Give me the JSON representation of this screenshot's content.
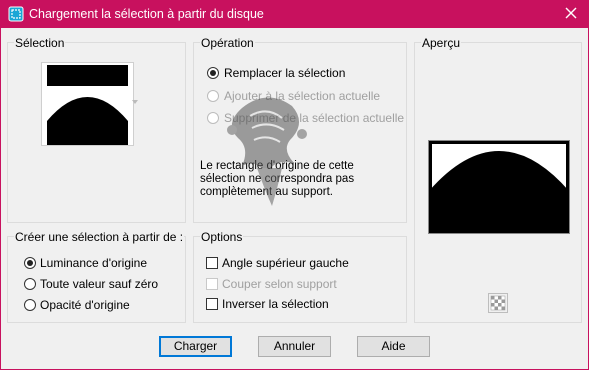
{
  "window": {
    "title": "Chargement la sélection à partir du disque",
    "close_glyph": "✕"
  },
  "selection_group": {
    "label": "Sélection"
  },
  "operation_group": {
    "label": "Opération",
    "options": [
      {
        "label": "Remplacer la sélection",
        "checked": true,
        "enabled": true
      },
      {
        "label": "Ajouter à la sélection actuelle",
        "checked": false,
        "enabled": false
      },
      {
        "label": "Supprimer de la sélection actuelle",
        "checked": false,
        "enabled": false
      }
    ],
    "info_text": "Le rectangle d'origine de cette sélection ne correspondra pas complètement au support."
  },
  "preview_group": {
    "label": "Aperçu"
  },
  "create_group": {
    "label": "Créer une sélection à partir de :",
    "options": [
      {
        "label": "Luminance d'origine",
        "checked": true
      },
      {
        "label": "Toute valeur sauf zéro",
        "checked": false
      },
      {
        "label": "Opacité d'origine",
        "checked": false
      }
    ]
  },
  "options_group": {
    "label": "Options",
    "items": [
      {
        "label": "Angle supérieur gauche",
        "checked": false,
        "enabled": true
      },
      {
        "label": "Couper selon support",
        "checked": false,
        "enabled": false
      },
      {
        "label": "Inverser la sélection",
        "checked": false,
        "enabled": true
      }
    ]
  },
  "buttons": {
    "ok": "Charger",
    "cancel": "Annuler",
    "help": "Aide"
  },
  "colors": {
    "titlebar": "#c8115e",
    "default_button_border": "#0078d7"
  },
  "icons": {
    "app": "selection-app-icon",
    "close": "close-icon",
    "transparency": "checkerboard-icon",
    "dropdown": "chevron-down-icon"
  }
}
